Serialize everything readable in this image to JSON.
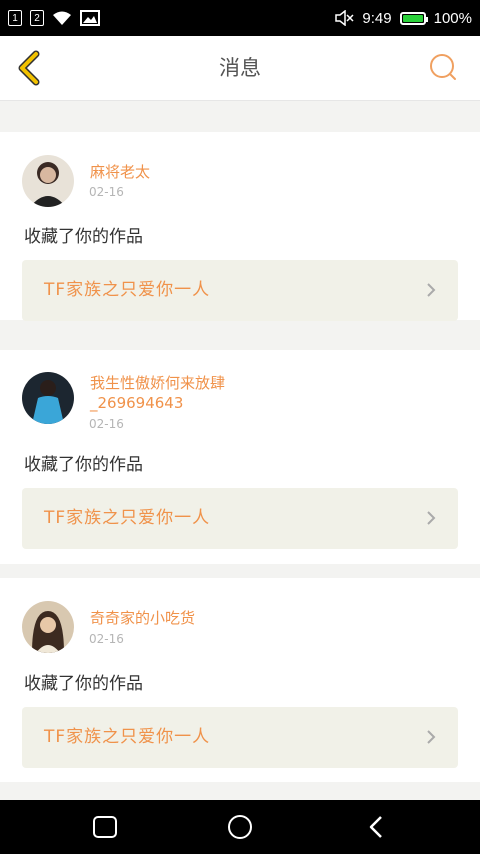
{
  "status": {
    "time": "9:49",
    "battery": "100%",
    "sim1": "1",
    "sim2": "2"
  },
  "header": {
    "title": "消息"
  },
  "messages": [
    {
      "user": "麻将老太",
      "date": "02-16",
      "action": "收藏了你的作品",
      "work": "TF家族之只爱你一人"
    },
    {
      "user": "我生性傲娇何来放肆_269694643",
      "date": "02-16",
      "action": "收藏了你的作品",
      "work": "TF家族之只爱你一人"
    },
    {
      "user": "奇奇家的小吃货",
      "date": "02-16",
      "action": "收藏了你的作品",
      "work": "TF家族之只爱你一人"
    }
  ],
  "colors": {
    "accent": "#f0924a",
    "back_arrow": "#f2c200",
    "work_bg": "#f1f1e8",
    "battery": "#2ad13a"
  },
  "icons": {
    "back": "back-arrow-icon",
    "search": "search-icon",
    "nav_recent": "square-icon",
    "nav_home": "circle-icon",
    "nav_back": "triangle-back-icon"
  }
}
